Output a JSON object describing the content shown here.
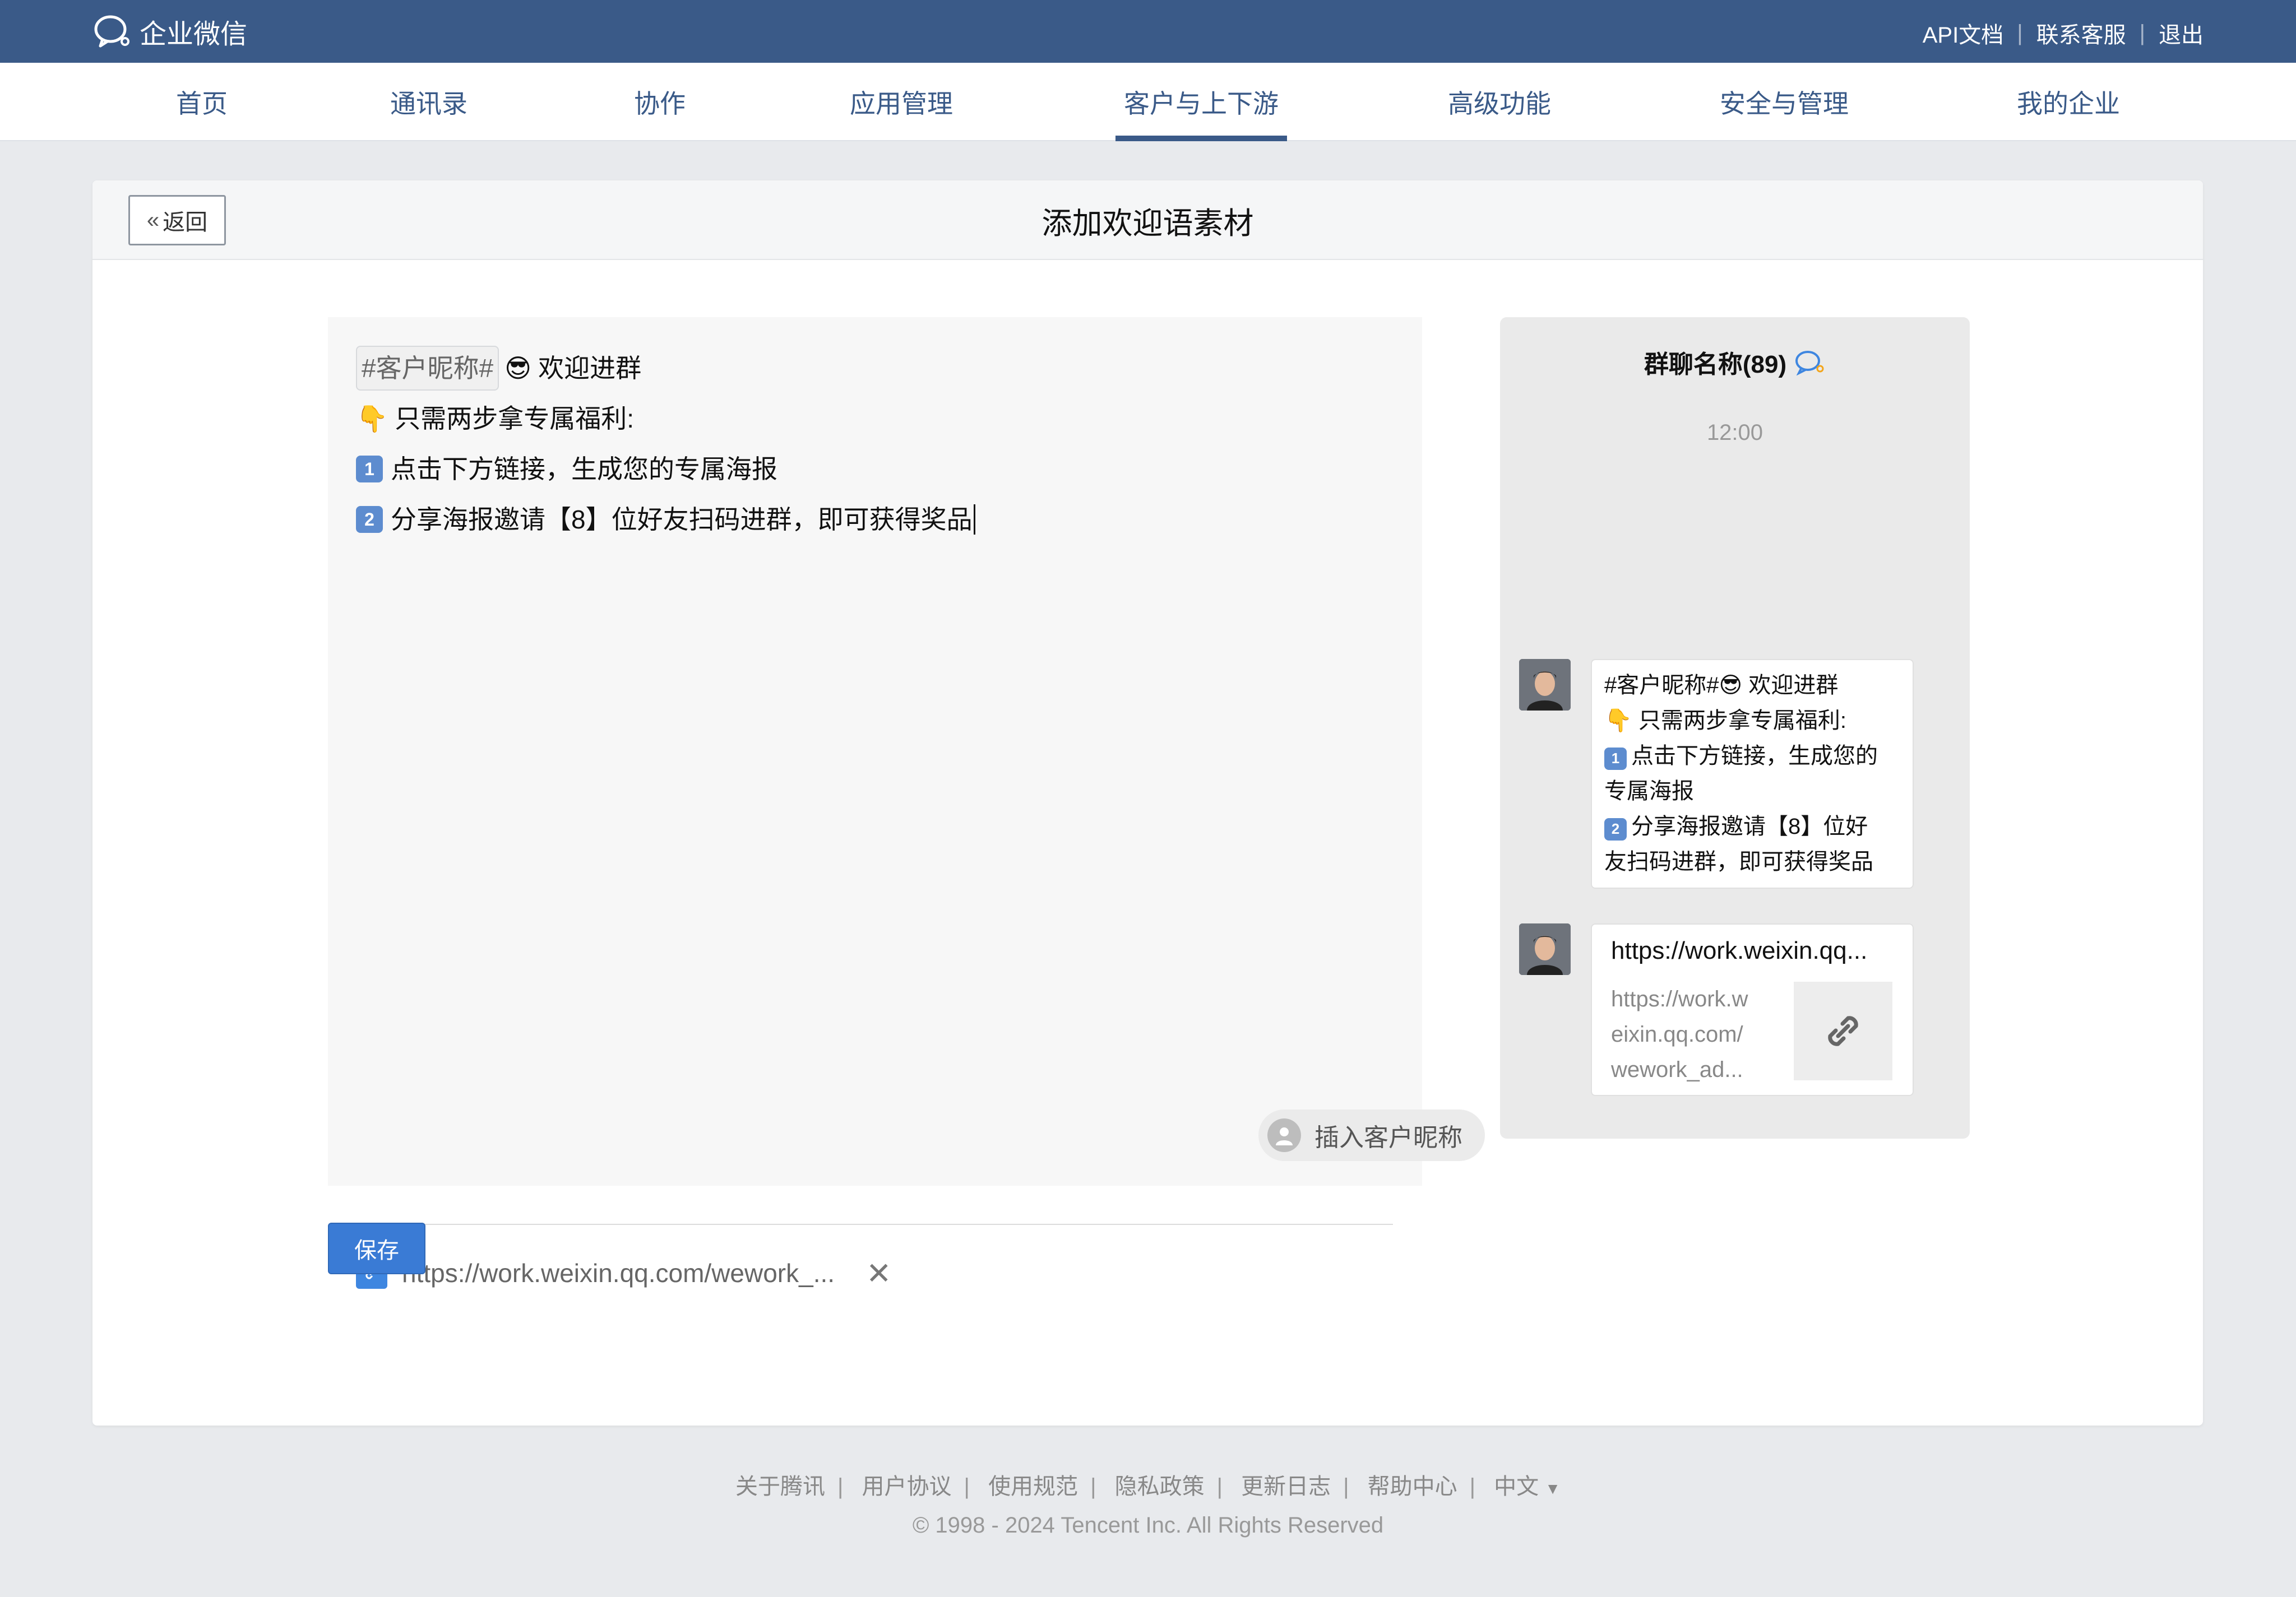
{
  "app": {
    "brand_name": "企业微信",
    "top_links": [
      "API文档",
      "联系客服",
      "退出"
    ]
  },
  "nav": {
    "items": [
      "首页",
      "通讯录",
      "协作",
      "应用管理",
      "客户与上下游",
      "高级功能",
      "安全与管理",
      "我的企业"
    ],
    "active_index": 4
  },
  "card": {
    "back_label": "返回",
    "title": "添加欢迎语素材"
  },
  "editor": {
    "tag_text": "#客户昵称#",
    "line1_text": "欢迎进群",
    "line2_text": "只需两步拿专属福利:",
    "line3_text": "点击下方链接，生成您的专属海报",
    "line4_text": "分享海报邀请【8】位好友扫码进群，即可获得奖品",
    "insert_label": "插入客户昵称",
    "link_text": "https://work.weixin.qq.com/wework_...",
    "close_label": "✕"
  },
  "save_label": "保存",
  "preview": {
    "title": "群聊名称(89)",
    "time": "12:00",
    "msg_line1": "#客户昵称#",
    "msg_line1_tail": "欢迎进群",
    "msg_line2": "只需两步拿专属福利:",
    "msg_line3a": "点击下方链接，生成您的",
    "msg_line3b": "专属海报",
    "msg_line4a": "分享海报邀请【8】位好",
    "msg_line4b": "友扫码进群，即可获得奖品",
    "link_title": "https://work.weixin.qq...",
    "link_desc_1": "https://work.w",
    "link_desc_2": "eixin.qq.com/",
    "link_desc_3": "wework_ad..."
  },
  "footer": {
    "links": [
      "关于腾讯",
      "用户协议",
      "使用规范",
      "隐私政策",
      "更新日志",
      "帮助中心",
      "中文"
    ],
    "copyright": "© 1998 - 2024 Tencent Inc. All Rights Reserved"
  },
  "colors": {
    "topbar": "#3a5a88",
    "accent": "#3a7bd5",
    "keycap": "#5d8ccf"
  }
}
